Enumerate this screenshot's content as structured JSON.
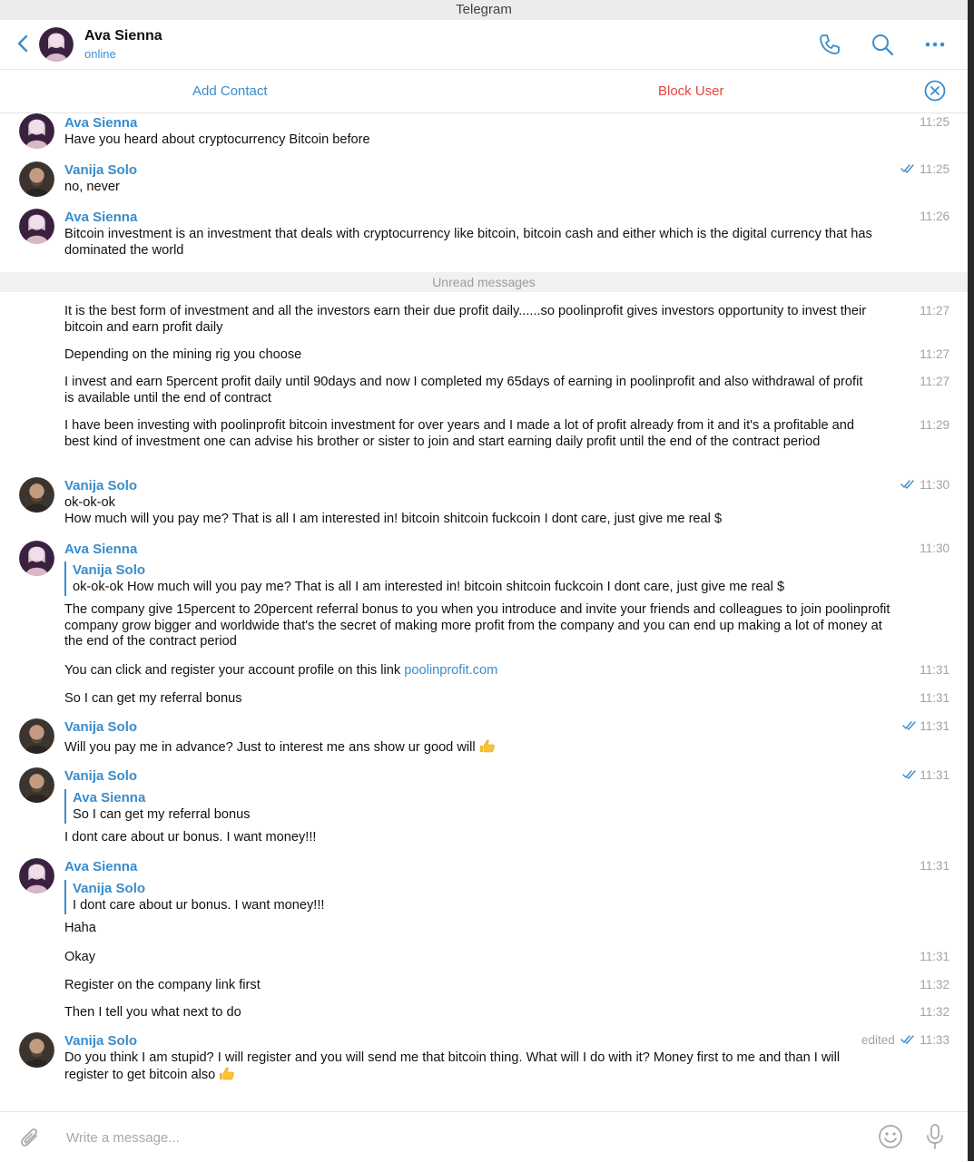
{
  "window": {
    "title": "Telegram"
  },
  "header": {
    "name": "Ava Sienna",
    "status": "online"
  },
  "actions": {
    "add_contact": "Add Contact",
    "block_user": "Block User"
  },
  "divider": {
    "unread": "Unread messages"
  },
  "messages": [
    {
      "sender": "Ava Sienna",
      "time": "11:25",
      "text": "Have you heard about cryptocurrency Bitcoin before"
    },
    {
      "sender": "Vanija Solo",
      "time": "11:25",
      "text": "no, never",
      "read": true
    },
    {
      "sender": "Ava Sienna",
      "time": "11:26",
      "text": "Bitcoin investment is an investment that deals with cryptocurrency like bitcoin, bitcoin cash and either which is the digital currency that has dominated the world"
    },
    {
      "time": "11:27",
      "text": "It is the best form of investment and all the investors earn their due profit daily......so poolinprofit gives investors opportunity to invest their bitcoin  and earn profit daily"
    },
    {
      "time": "11:27",
      "text": "Depending on the mining rig you choose"
    },
    {
      "time": "11:27",
      "text": "I invest and earn 5percent profit daily until 90days and now I completed my 65days of earning in poolinprofit and also withdrawal of profit is available until the end of contract"
    },
    {
      "time": "11:29",
      "text": "I have been investing with poolinprofit bitcoin investment for over years and I made a lot of profit already  from  it  and it's a profitable and best kind of investment one can advise his brother  or sister  to join and start earning daily profit until the end of  the contract period"
    },
    {
      "sender": "Vanija Solo",
      "time": "11:30",
      "read": true,
      "text": "ok-ok-ok",
      "text2": "How much will you pay me? That is all I am interested in! bitcoin shitcoin fuckcoin I dont care, just give me real $"
    },
    {
      "sender": "Ava Sienna",
      "time": "11:30",
      "reply_name": "Vanija Solo",
      "reply_text": "ok-ok-ok How much will you pay me? That is all I am interested in! bitcoin shitcoin fuckcoin I dont care, just give me real $",
      "text": "The company give 15percent to 20percent referral bonus to you when you introduce and invite your friends and colleagues to join poolinprofit company grow bigger and worldwide that's the secret of making   more profit from the company and you can end up making a lot of money at the end of the contract period"
    },
    {
      "time": "11:31",
      "text": "You can click  and register your account profile on this link ",
      "link": "poolinprofit.com"
    },
    {
      "time": "11:31",
      "text": "So I can get my referral bonus"
    },
    {
      "sender": "Vanija Solo",
      "time": "11:31",
      "read": true,
      "text": "Will you pay me in advance? Just to interest me ans show ur good will",
      "emoji": "thumbs-up"
    },
    {
      "sender": "Vanija Solo",
      "time": "11:31",
      "read": true,
      "reply_name": "Ava Sienna",
      "reply_text": "So I can get my referral bonus",
      "text": "I dont care about ur bonus. I want money!!!"
    },
    {
      "sender": "Ava Sienna",
      "time": "11:31",
      "reply_name": "Vanija Solo",
      "reply_text": "I dont care about ur bonus. I want money!!!",
      "text": "Haha"
    },
    {
      "time": "11:31",
      "text": "Okay"
    },
    {
      "time": "11:32",
      "text": "Register on the company link first"
    },
    {
      "time": "11:32",
      "text": "Then I tell you what next to do"
    },
    {
      "sender": "Vanija Solo",
      "time": "11:33",
      "read": true,
      "edited": "edited",
      "text": "Do you think I am stupid? I will register and you will send me that bitcoin thing. What will I do with it? Money first to me and than I will register to get bitcoin also",
      "emoji": "thumbs-up"
    }
  ],
  "composer": {
    "placeholder": "Write a message..."
  },
  "colors": {
    "accent": "#3a8ccb",
    "danger": "#e0463f",
    "muted": "#a3a3a3"
  }
}
